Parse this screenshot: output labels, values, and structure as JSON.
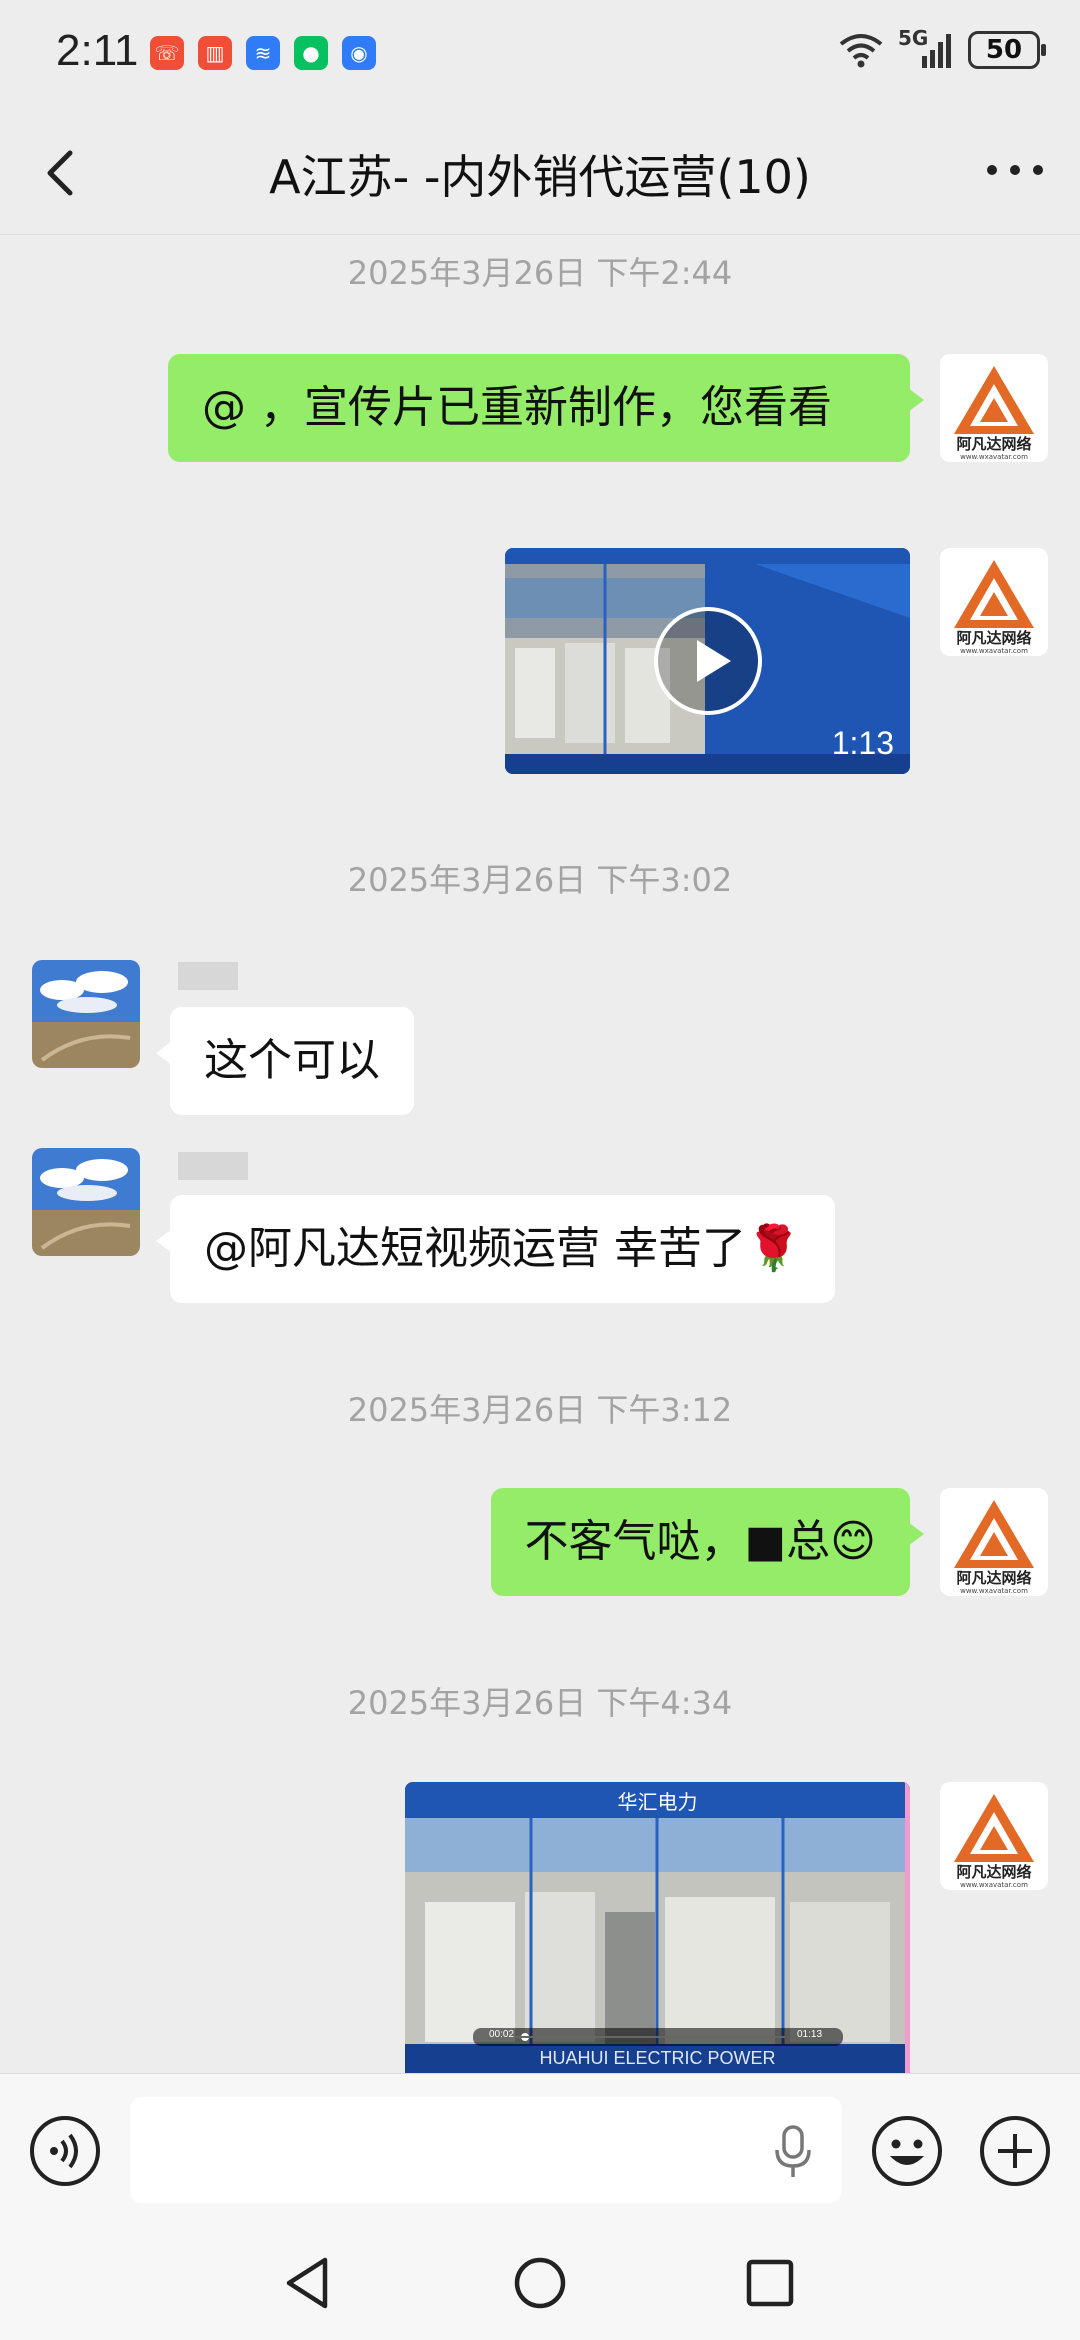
{
  "status_bar": {
    "time": "2:11",
    "battery": "50",
    "network": "5G"
  },
  "header": {
    "title": "A江苏‑ ‑内外销代运营(10)"
  },
  "messages": {
    "ts1": "2025年3月26日 下午2:44",
    "msg1_text": "@‌‌‌‌‌‌ ‌‌‌，宣传片已重新制作，您看看",
    "video1_duration": "1:13",
    "ts2": "2025年3月26日 下午3:02",
    "msg2_text": "这个可以",
    "msg3_text": "@阿凡达短视频运营 幸苦了🌹",
    "ts3": "2025年3月26日 下午3:12",
    "msg4_text": "不客气哒，‌■总😊",
    "ts4": "2025年3月26日 下午4:34",
    "video2_title": "华汇电力",
    "video2_caption": "HUAHUI ELECTRIC POWER",
    "video2_time_current": "00:02",
    "video2_time_total": "01:13"
  },
  "avatar": {
    "logo_text": "阿凡达网络",
    "logo_url": "www.wxavatar.com"
  },
  "input": {
    "placeholder": ""
  },
  "colors": {
    "bubble_green": "#95ec69",
    "background": "#ededed",
    "logo_orange": "#e26a26"
  }
}
